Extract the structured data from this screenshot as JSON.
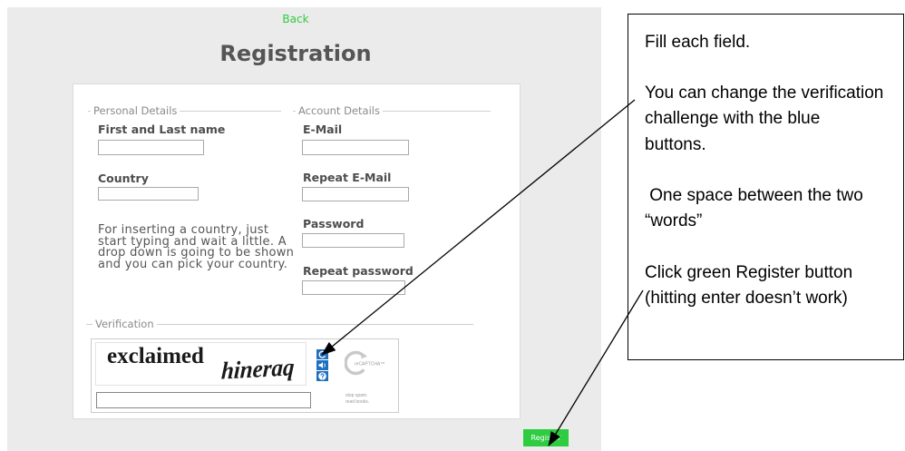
{
  "page": {
    "back_link": "Back",
    "title": "Registration"
  },
  "form": {
    "personal_legend": "Personal Details",
    "account_legend": "Account Details",
    "name": {
      "label": "First and Last name",
      "value": ""
    },
    "country": {
      "label": "Country",
      "value": ""
    },
    "country_hint_lines": [
      "For inserting a country, just",
      "start typing and wait a little. A",
      "drop down is going to be shown",
      "and you can pick your country."
    ],
    "email": {
      "label": "E-Mail",
      "value": ""
    },
    "repeat_email": {
      "label": "Repeat E-Mail",
      "value": ""
    },
    "password": {
      "label": "Password",
      "value": ""
    },
    "repeat_password": {
      "label": "Repeat password",
      "value": ""
    },
    "verification_legend": "Verification",
    "captcha": {
      "words": [
        "exclaimed",
        "hineraq"
      ],
      "response_value": "",
      "button_icons": [
        "refresh-icon",
        "audio-icon",
        "help-icon"
      ],
      "brand": "reCAPTCHA™",
      "slogan_lines": [
        "stop spam.",
        "read books."
      ]
    },
    "register_label": "Register"
  },
  "annotation": {
    "paragraphs": [
      [
        "Fill each field."
      ],
      [
        "You can change the verification",
        "challenge with the blue",
        "buttons."
      ],
      [
        " One space between the two",
        "“words”"
      ],
      [
        "Click green Register button",
        "(hitting enter doesn’t work)"
      ]
    ]
  },
  "colors": {
    "accent_green": "#2ecc40",
    "captcha_blue": "#1f6fbf",
    "panel_gray": "#ebebeb",
    "heading_gray": "#555555"
  }
}
